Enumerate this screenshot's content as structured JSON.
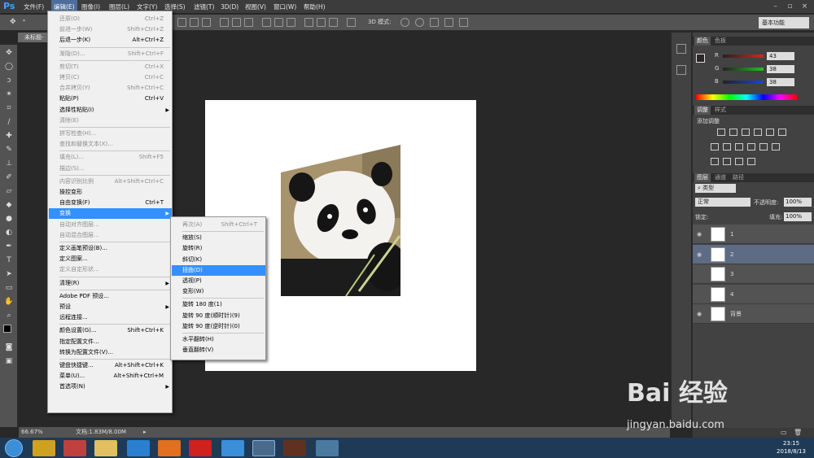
{
  "app": {
    "logo": "Ps"
  },
  "menubar": [
    {
      "label": "文件(F)",
      "active": false
    },
    {
      "label": "编辑(E)",
      "active": true
    },
    {
      "label": "图像(I)",
      "active": false
    },
    {
      "label": "图层(L)",
      "active": false
    },
    {
      "label": "文字(Y)",
      "active": false
    },
    {
      "label": "选择(S)",
      "active": false
    },
    {
      "label": "滤镜(T)",
      "active": false
    },
    {
      "label": "3D(D)",
      "active": false
    },
    {
      "label": "视图(V)",
      "active": false
    },
    {
      "label": "窗口(W)",
      "active": false
    },
    {
      "label": "帮助(H)",
      "active": false
    }
  ],
  "options_bar": {
    "mode_3d_label": "3D 模式:",
    "workspace": "基本功能"
  },
  "document_tab": {
    "title": "未标题-"
  },
  "edit_menu": [
    {
      "label": "还原(O)",
      "shortcut": "Ctrl+Z",
      "disabled": true
    },
    {
      "label": "前进一步(W)",
      "shortcut": "Shift+Ctrl+Z",
      "disabled": true
    },
    {
      "label": "后退一步(K)",
      "shortcut": "Alt+Ctrl+Z",
      "disabled": false
    },
    {
      "sep": true
    },
    {
      "label": "渐隐(D)...",
      "shortcut": "Shift+Ctrl+F",
      "disabled": true
    },
    {
      "sep": true
    },
    {
      "label": "剪切(T)",
      "shortcut": "Ctrl+X",
      "disabled": true
    },
    {
      "label": "拷贝(C)",
      "shortcut": "Ctrl+C",
      "disabled": true
    },
    {
      "label": "合并拷贝(Y)",
      "shortcut": "Shift+Ctrl+C",
      "disabled": true
    },
    {
      "label": "粘贴(P)",
      "shortcut": "Ctrl+V",
      "disabled": false
    },
    {
      "label": "选择性粘贴(I)",
      "shortcut": "",
      "disabled": false,
      "submenu": true
    },
    {
      "label": "清除(E)",
      "shortcut": "",
      "disabled": true
    },
    {
      "sep": true
    },
    {
      "label": "拼写检查(H)...",
      "shortcut": "",
      "disabled": true
    },
    {
      "label": "查找和替换文本(X)...",
      "shortcut": "",
      "disabled": true
    },
    {
      "sep": true
    },
    {
      "label": "填充(L)...",
      "shortcut": "Shift+F5",
      "disabled": true
    },
    {
      "label": "描边(S)...",
      "shortcut": "",
      "disabled": true
    },
    {
      "sep": true
    },
    {
      "label": "内容识别比例",
      "shortcut": "Alt+Shift+Ctrl+C",
      "disabled": true
    },
    {
      "label": "操控变形",
      "shortcut": "",
      "disabled": false
    },
    {
      "label": "自由变换(F)",
      "shortcut": "Ctrl+T",
      "disabled": false
    },
    {
      "label": "变换",
      "shortcut": "",
      "disabled": false,
      "submenu": true,
      "highlighted": true
    },
    {
      "label": "自动对齐图层...",
      "shortcut": "",
      "disabled": true
    },
    {
      "label": "自动混合图层...",
      "shortcut": "",
      "disabled": true
    },
    {
      "sep": true
    },
    {
      "label": "定义画笔预设(B)...",
      "shortcut": "",
      "disabled": false
    },
    {
      "label": "定义图案...",
      "shortcut": "",
      "disabled": false
    },
    {
      "label": "定义自定形状...",
      "shortcut": "",
      "disabled": true
    },
    {
      "sep": true
    },
    {
      "label": "清理(R)",
      "shortcut": "",
      "disabled": false,
      "submenu": true
    },
    {
      "sep": true
    },
    {
      "label": "Adobe PDF 预设...",
      "shortcut": "",
      "disabled": false
    },
    {
      "label": "预设",
      "shortcut": "",
      "disabled": false,
      "submenu": true
    },
    {
      "label": "远程连接...",
      "shortcut": "",
      "disabled": false
    },
    {
      "sep": true
    },
    {
      "label": "颜色设置(G)...",
      "shortcut": "Shift+Ctrl+K",
      "disabled": false
    },
    {
      "label": "指定配置文件...",
      "shortcut": "",
      "disabled": false
    },
    {
      "label": "转换为配置文件(V)...",
      "shortcut": "",
      "disabled": false
    },
    {
      "sep": true
    },
    {
      "label": "键盘快捷键...",
      "shortcut": "Alt+Shift+Ctrl+K",
      "disabled": false
    },
    {
      "label": "菜单(U)...",
      "shortcut": "Alt+Shift+Ctrl+M",
      "disabled": false
    },
    {
      "label": "首选项(N)",
      "shortcut": "",
      "disabled": false,
      "submenu": true
    }
  ],
  "transform_submenu": [
    {
      "label": "再次(A)",
      "shortcut": "Shift+Ctrl+T",
      "disabled": true
    },
    {
      "sep": true
    },
    {
      "label": "缩放(S)",
      "shortcut": "",
      "disabled": false
    },
    {
      "label": "旋转(R)",
      "shortcut": "",
      "disabled": false
    },
    {
      "label": "斜切(K)",
      "shortcut": "",
      "disabled": false
    },
    {
      "label": "扭曲(D)",
      "shortcut": "",
      "disabled": false,
      "highlighted": true
    },
    {
      "label": "透视(P)",
      "shortcut": "",
      "disabled": false
    },
    {
      "label": "变形(W)",
      "shortcut": "",
      "disabled": false
    },
    {
      "sep": true
    },
    {
      "label": "旋转 180 度(1)",
      "shortcut": "",
      "disabled": false
    },
    {
      "label": "旋转 90 度(顺时针)(9)",
      "shortcut": "",
      "disabled": false
    },
    {
      "label": "旋转 90 度(逆时针)(0)",
      "shortcut": "",
      "disabled": false
    },
    {
      "sep": true
    },
    {
      "label": "水平翻转(H)",
      "shortcut": "",
      "disabled": false
    },
    {
      "label": "垂直翻转(V)",
      "shortcut": "",
      "disabled": false
    }
  ],
  "color_panel": {
    "tabs": [
      "颜色",
      "色板"
    ],
    "channels": [
      {
        "label": "R",
        "value": "43",
        "color": "#e02020"
      },
      {
        "label": "G",
        "value": "38",
        "color": "#20c020"
      },
      {
        "label": "B",
        "value": "38",
        "color": "#2040e0"
      }
    ]
  },
  "adjust_panel": {
    "tabs": [
      "调整",
      "样式"
    ],
    "title": "添加调整"
  },
  "layers_panel": {
    "tabs": [
      "图层",
      "通道",
      "路径"
    ],
    "filter": "类型",
    "blend_mode": "正常",
    "opacity_label": "不透明度:",
    "opacity": "100%",
    "lock_label": "锁定:",
    "fill_label": "填充:",
    "fill": "100%",
    "layers": [
      {
        "name": "1",
        "visible": true,
        "selected": false
      },
      {
        "name": "2",
        "visible": true,
        "selected": true
      },
      {
        "name": "3",
        "visible": false,
        "selected": false
      },
      {
        "name": "4",
        "visible": false,
        "selected": false
      },
      {
        "name": "背景",
        "visible": true,
        "selected": false
      }
    ]
  },
  "status": {
    "zoom": "66.67%",
    "doc_info": "文档:1.83M/8.00M"
  },
  "taskbar": {
    "time": "23:15",
    "date": "2018/8/13"
  },
  "watermark": {
    "text": "Bai 经验",
    "url": "jingyan.baidu.com"
  }
}
